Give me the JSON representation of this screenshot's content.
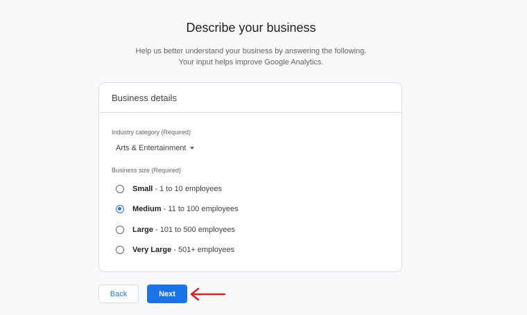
{
  "header": {
    "title": "Describe your business",
    "subtitle_line1": "Help us better understand your business by answering the following.",
    "subtitle_line2": "Your input helps improve Google Analytics."
  },
  "card": {
    "title": "Business details",
    "industry": {
      "label": "Industry category (Required)",
      "selected": "Arts & Entertainment"
    },
    "size": {
      "label": "Business size (Required)",
      "options": [
        {
          "name": "Small",
          "detail": " - 1 to 10 employees",
          "checked": false
        },
        {
          "name": "Medium",
          "detail": " - 11 to 100 employees",
          "checked": true
        },
        {
          "name": "Large",
          "detail": " - 101 to 500 employees",
          "checked": false
        },
        {
          "name": "Very Large",
          "detail": " - 501+ employees",
          "checked": false
        }
      ]
    }
  },
  "buttons": {
    "back_label": "Back",
    "next_label": "Next"
  },
  "colors": {
    "accent": "#1a73e8",
    "annotation_arrow": "#e02020"
  },
  "icons": {
    "dropdown": "caret-down-icon",
    "annotation": "red-arrow-icon"
  }
}
